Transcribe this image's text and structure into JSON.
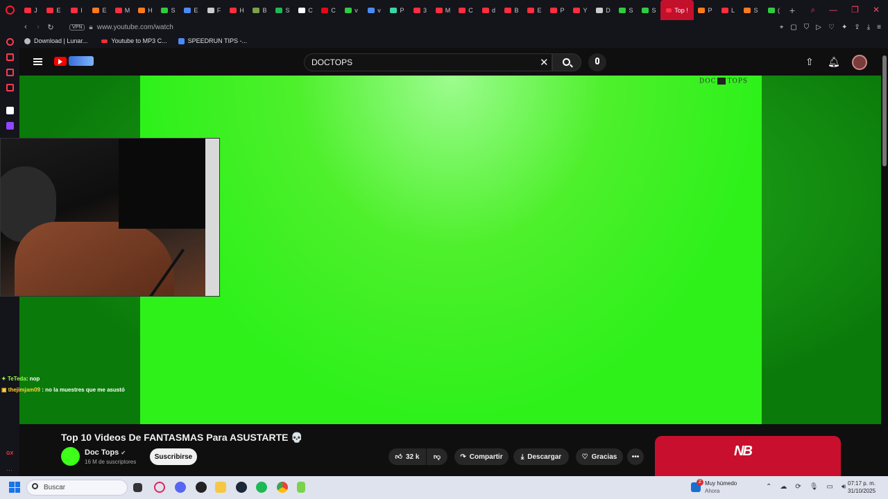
{
  "browser": {
    "tabs": [
      "J",
      "E",
      "I",
      "E",
      "M",
      "H",
      "S",
      "E",
      "F",
      "H",
      "B",
      "S",
      "C",
      "C",
      "v",
      "v",
      "P",
      "3",
      "M",
      "C",
      "d",
      "B",
      "E",
      "P",
      "Y",
      "D",
      "S",
      "S"
    ],
    "active_tab": "Top !",
    "tabs_after": [
      "P",
      "L",
      "S",
      "("
    ],
    "new_tab": "+",
    "url": "www.youtube.com/watch",
    "vpn": "VPN",
    "bookmarks": [
      "Download | Lunar...",
      "Youtube to MP3 C...",
      "SPEEDRUN TIPS -..."
    ]
  },
  "youtube": {
    "search_value": "DOCTOPS",
    "watermark_left": "DOC",
    "watermark_right": "TOPS",
    "video_title": "Top 10 Videos De FANTASMAS Para ASUSTARTE 💀",
    "channel_name": "Doc Tops",
    "verified_icon": "✔",
    "subscribers": "16 M de suscriptores",
    "subscribe_label": "Suscribirse",
    "likes": "32 k",
    "share_label": "Compartir",
    "download_label": "Descargar",
    "thanks_label": "Gracias",
    "more_label": "•••"
  },
  "chat": [
    {
      "user": "TeTeda",
      "message": ": nop"
    },
    {
      "user": "thejimjam09",
      "message": ": no la muestres que me asustó"
    }
  ],
  "taskbar": {
    "search_placeholder": "Buscar",
    "weather_title": "Muy húmedo",
    "weather_sub": "Ahora",
    "weather_badge": "2",
    "time": "07:17 p. m.",
    "date": "31/10/2025"
  },
  "colors": {
    "accent": "#ff0000",
    "opera_red": "#ff1b2d",
    "green_screen": "#2ef11a"
  }
}
